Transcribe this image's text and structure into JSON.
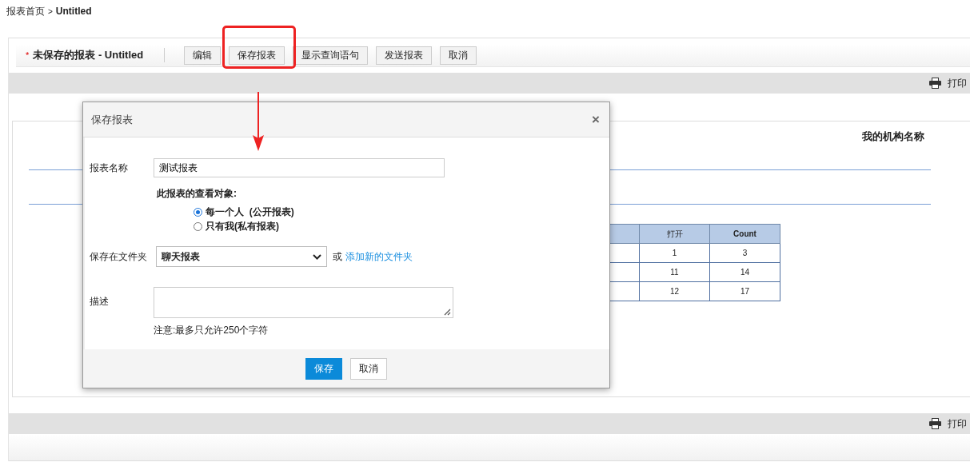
{
  "breadcrumb": {
    "items": [
      {
        "label": "报表首页",
        "current": false
      },
      {
        "label": "Untitled",
        "current": true
      }
    ],
    "separator": ">"
  },
  "toolbar": {
    "required_mark": "*",
    "title": "未保存的报表 - Untitled",
    "buttons": [
      {
        "label": "编辑",
        "highlighted": false
      },
      {
        "label": "保存报表",
        "highlighted": true
      },
      {
        "label": "显示查询语句",
        "highlighted": false
      },
      {
        "label": "发送报表",
        "highlighted": false
      },
      {
        "label": "取消",
        "highlighted": false
      }
    ]
  },
  "print_bars": [
    {
      "label": "打印"
    },
    {
      "label": "打印"
    }
  ],
  "report": {
    "org_name": "我的机构名称",
    "table": {
      "columns": [
        "打开",
        "Count"
      ],
      "rows": [
        [
          "1",
          "3"
        ],
        [
          "11",
          "14"
        ],
        [
          "12",
          "17"
        ]
      ]
    }
  },
  "dialog": {
    "title": "保存报表",
    "close": "×",
    "name_label": "报表名称",
    "name_value": "测试报表",
    "audience_heading": "此报表的查看对象:",
    "audience_options": [
      {
        "label": "每一个人  (公开报表)",
        "selected": true
      },
      {
        "label": "只有我(私有报表)",
        "selected": false
      }
    ],
    "folder_label": "保存在文件夹",
    "folder_value": "聊天报表",
    "or_text": "或",
    "add_folder_link": "添加新的文件夹",
    "description_label": "描述",
    "note": "注意:最多只允许250个字符",
    "buttons": [
      {
        "label": "保存",
        "kind": "primary"
      },
      {
        "label": "取消",
        "kind": "default"
      }
    ]
  }
}
